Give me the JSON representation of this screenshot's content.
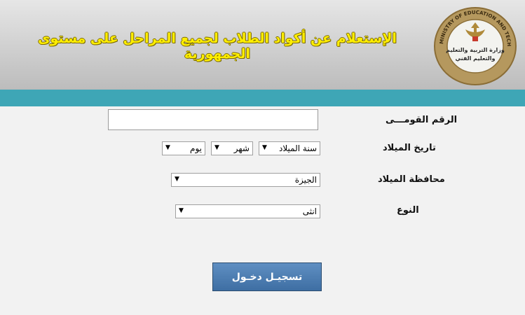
{
  "header": {
    "title": "الإستعلام عن أكواد الطلاب لجميع المراحل على مستوى الجمهورية",
    "logo": {
      "text_top": "MINISTRY OF EDUCATION AND TECHNICAL EDUCATION",
      "text_center_line1": "وزارة التربية والتعليم",
      "text_center_line2": "والتعليم الفني"
    },
    "bar_color": "#3ea6b6"
  },
  "form": {
    "national_id": {
      "label": "الرقم القومـــى",
      "value": ""
    },
    "birth_date": {
      "label": "تاريخ الميلاد",
      "year": "سنة الميلاد",
      "month": "شهر",
      "day": "يوم"
    },
    "birth_governorate": {
      "label": "محافظة الميلاد",
      "value": "الجيزة"
    },
    "gender": {
      "label": "النوع",
      "value": "انثى"
    },
    "submit_label": "تسجيـل دخـول"
  }
}
